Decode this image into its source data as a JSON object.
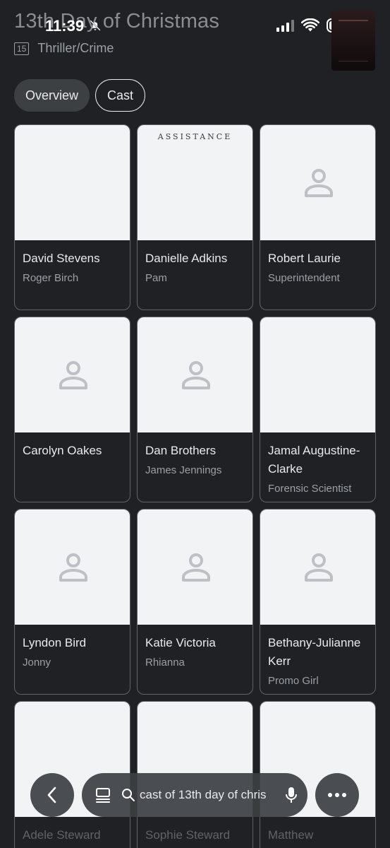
{
  "status_bar": {
    "time": "11:39"
  },
  "header": {
    "title": "13th Day of Christmas",
    "rating": "15",
    "genre": "Thriller/Crime"
  },
  "tabs": [
    {
      "label": "Overview",
      "active": false
    },
    {
      "label": "Cast",
      "active": true
    }
  ],
  "cast": [
    {
      "name": "David Stevens",
      "role": "Roger Birch",
      "photo": "photo"
    },
    {
      "name": "Danielle Adkins",
      "role": "Pam",
      "photo": "poster",
      "poster_text": "ASSISTANCE"
    },
    {
      "name": "Robert Laurie",
      "role": "Superintendent",
      "photo": "placeholder"
    },
    {
      "name": "Carolyn Oakes",
      "role": "",
      "photo": "placeholder"
    },
    {
      "name": "Dan Brothers",
      "role": "James Jennings",
      "photo": "placeholder"
    },
    {
      "name": "Jamal Augustine-Clarke",
      "role": "Forensic Scientist",
      "photo": "photo"
    },
    {
      "name": "Lyndon Bird",
      "role": "Jonny",
      "photo": "placeholder"
    },
    {
      "name": "Katie Victoria",
      "role": "Rhianna",
      "photo": "placeholder"
    },
    {
      "name": "Bethany-Julianne Kerr",
      "role": "Promo Girl",
      "photo": "placeholder"
    },
    {
      "name": "Adele Steward",
      "role": "",
      "photo": "photo"
    },
    {
      "name": "Sophie Steward",
      "role": "",
      "photo": "photo"
    },
    {
      "name": "Matthew",
      "role": "",
      "photo": "photo"
    }
  ],
  "bottom_bar": {
    "search_text": "cast of 13th day of chris",
    "icons": [
      "back-icon",
      "tabs-icon",
      "search-icon",
      "mic-icon",
      "more-icon"
    ]
  },
  "colors": {
    "background": "#202124",
    "card_border": "#5f6368",
    "text_primary": "#e8eaed",
    "text_secondary": "#9aa0a6",
    "placeholder_bg": "#f1f3f4"
  }
}
